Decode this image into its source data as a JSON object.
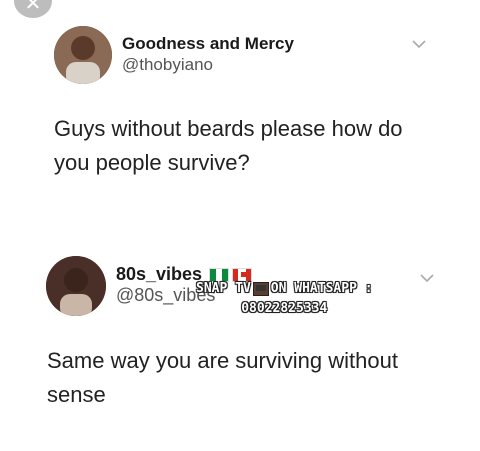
{
  "tweet1": {
    "display_name": "Goodness and Mercy",
    "handle": "@thobyiano",
    "text": "Guys without beards please how do you people survive?"
  },
  "tweet2": {
    "display_name": "80s_vibes",
    "handle": "@80s_vibes",
    "flags": [
      "nigeria-flag",
      "canada-flag"
    ],
    "text": "Same way you are surviving without sense"
  },
  "watermark": {
    "line1_left": "SNAP TV",
    "line1_right": "ON WHATSAPP :",
    "line2": "08022825334"
  },
  "icons": {
    "close": "close-icon",
    "more": "chevron-down-icon"
  },
  "colors": {
    "background": "#ffffff",
    "text": "#1c1c1c",
    "handle": "#555555"
  }
}
